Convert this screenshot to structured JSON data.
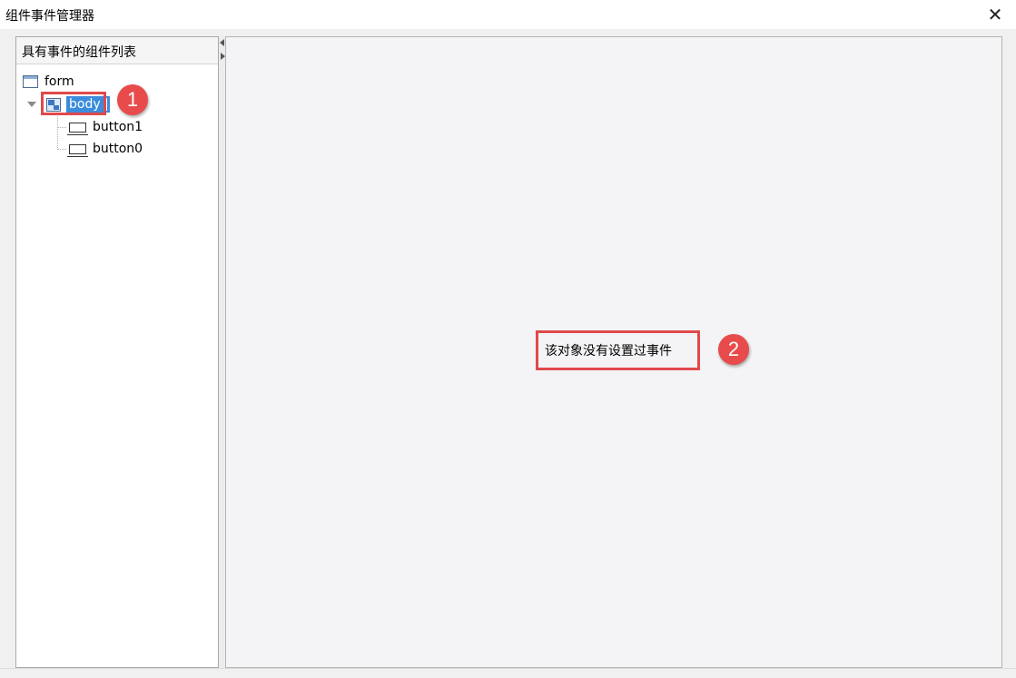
{
  "window": {
    "title": "组件事件管理器",
    "close_symbol": "✕"
  },
  "left_panel": {
    "header": "具有事件的组件列表",
    "tree": [
      {
        "label": "form",
        "icon": "form-icon"
      },
      {
        "label": "body",
        "icon": "body-icon",
        "selected": true,
        "expanded": true
      },
      {
        "label": "button1",
        "icon": "button-icon"
      },
      {
        "label": "button0",
        "icon": "button-icon"
      }
    ]
  },
  "right_panel": {
    "message": "该对象没有设置过事件"
  },
  "annotations": {
    "badge1": "1",
    "badge2": "2",
    "highlight_color": "#e0494b"
  },
  "colors": {
    "selection": "#3c8cdc",
    "badge": "#e84b4b"
  }
}
